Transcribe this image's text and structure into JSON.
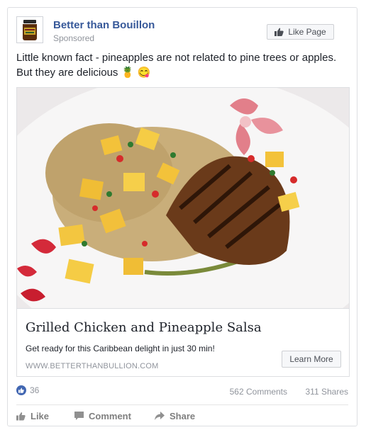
{
  "post": {
    "page_name": "Better than Bouillon",
    "sponsored_label": "Sponsored",
    "like_page_label": "Like Page",
    "message_line1": "Little known fact - pineapples are not related to pine trees or apples.",
    "message_line2": "But they are delicious",
    "message_emoji": "🍍 😋"
  },
  "link": {
    "title": "Grilled Chicken and Pineapple Salsa",
    "description": "Get ready for this Caribbean delight in just 30 min!",
    "domain": "WWW.BETTERTHANBULLION.COM",
    "cta_label": "Learn More"
  },
  "stats": {
    "likes": "36",
    "comments": "562 Comments",
    "shares": "311 Shares"
  },
  "actions": {
    "like": "Like",
    "comment": "Comment",
    "share": "Share"
  },
  "colors": {
    "link_blue": "#365899",
    "like_blue": "#4267b2",
    "muted": "#90949c"
  },
  "icons": [
    "thumbs-up-icon",
    "comment-icon",
    "share-icon",
    "pineapple-emoji",
    "yum-emoji"
  ]
}
